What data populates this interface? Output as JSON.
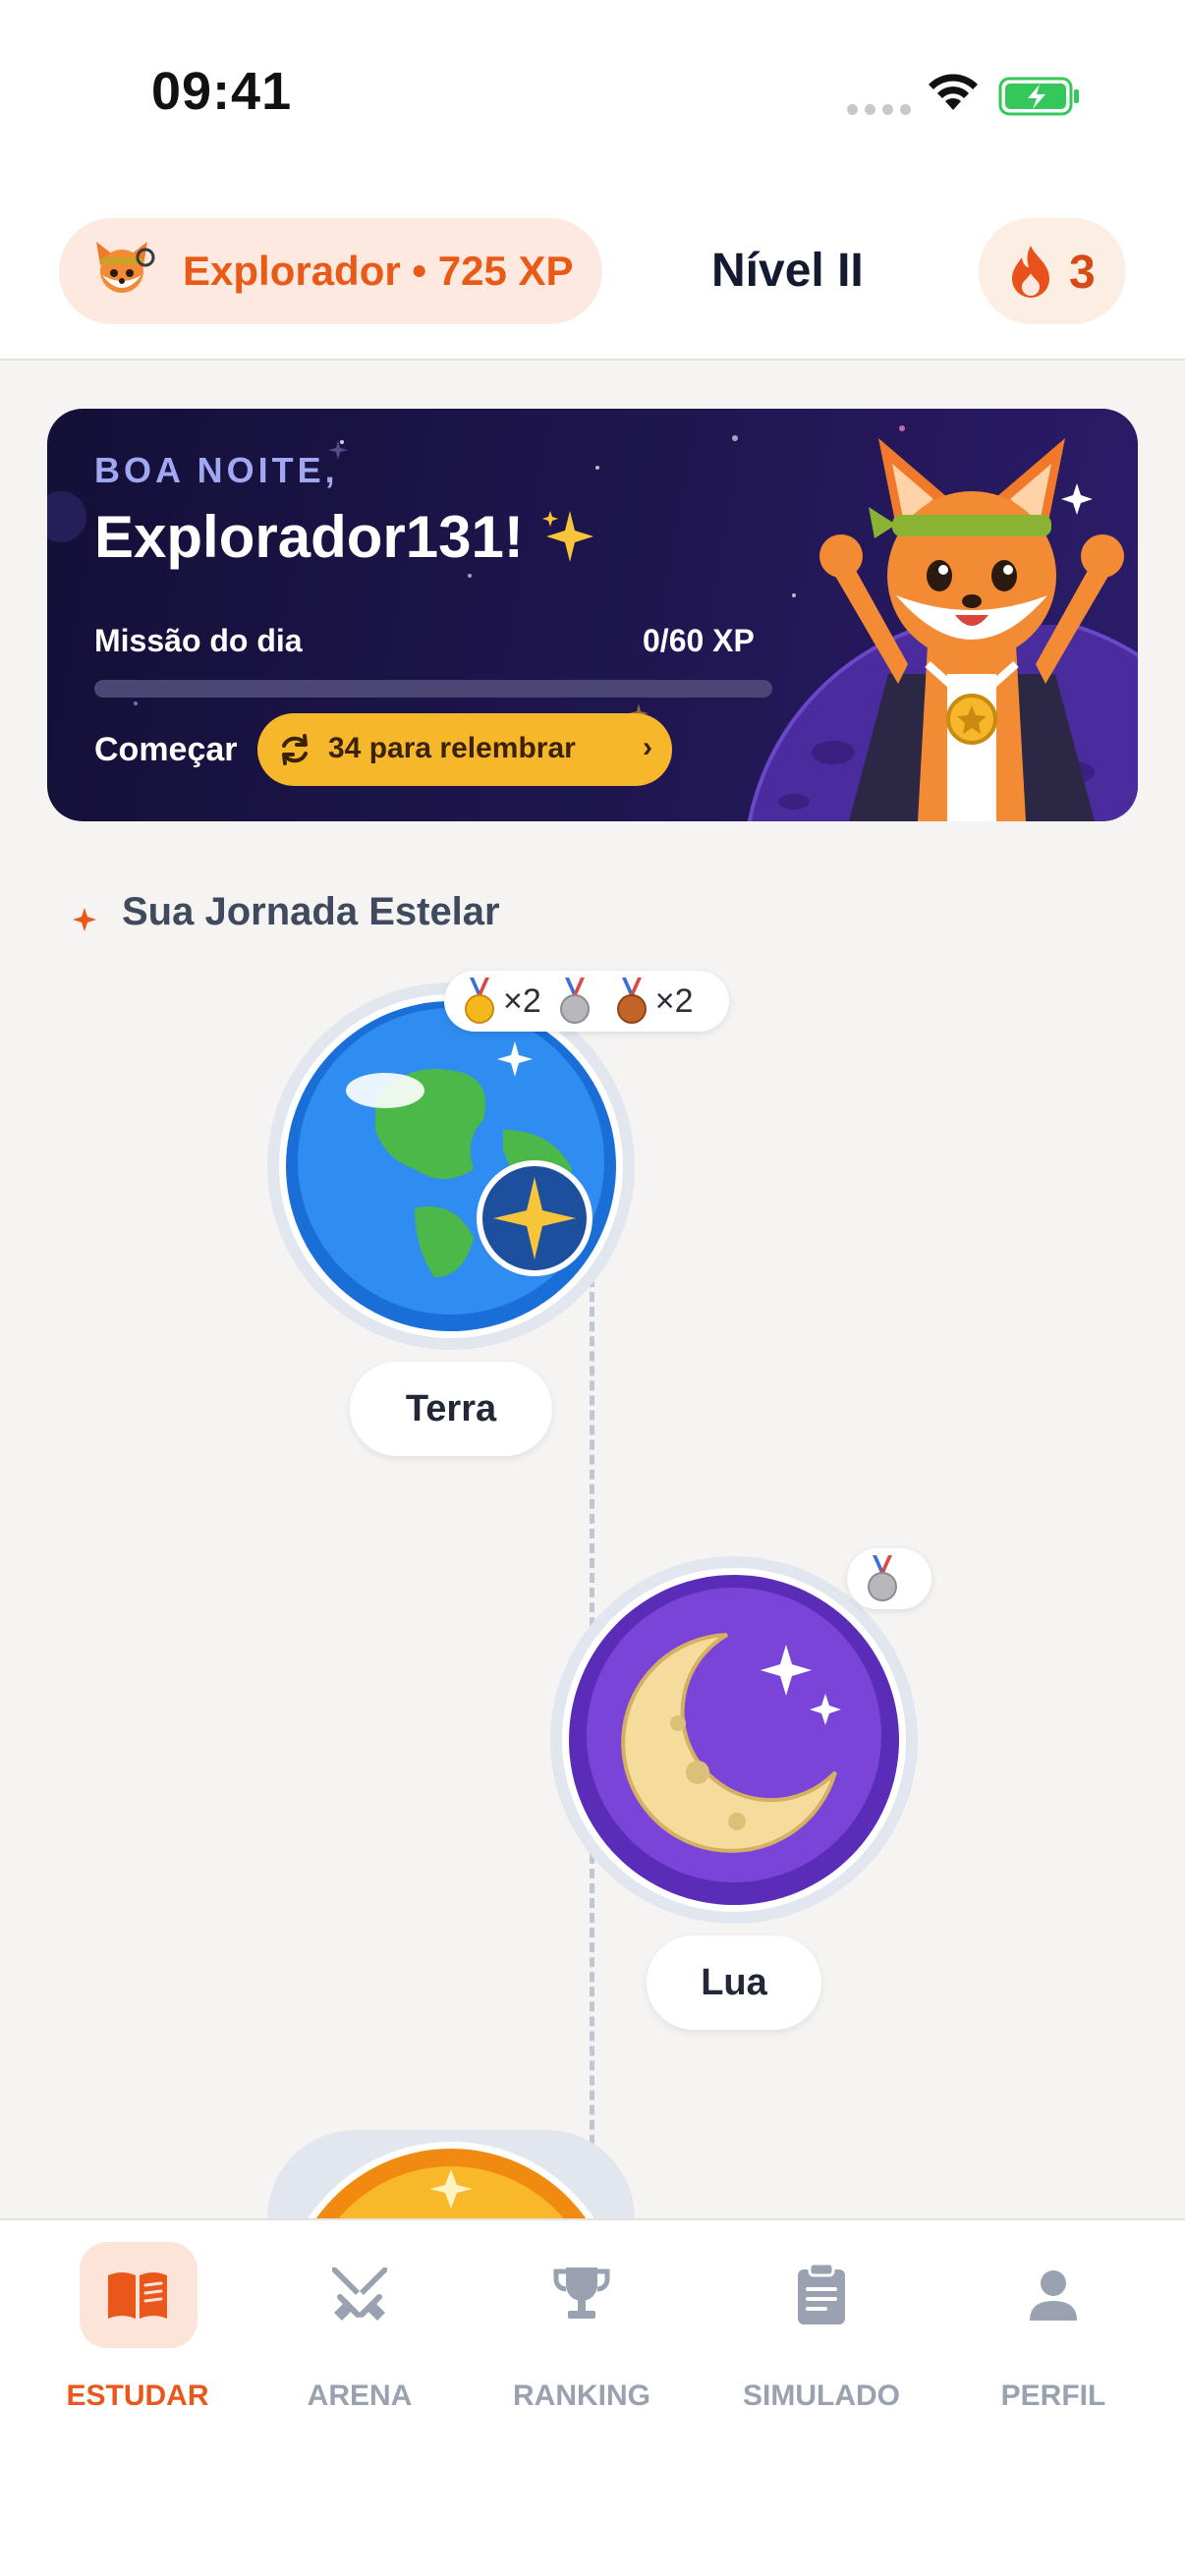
{
  "status_bar": {
    "time": "09:41"
  },
  "header": {
    "xp_label": "Explorador • 725 XP",
    "level": "Nível II",
    "streak": "3"
  },
  "banner": {
    "greeting": "BOA NOITE,",
    "username": "Explorador131!",
    "mission_label": "Missão do dia",
    "mission_xp": "0/60 XP",
    "mission_progress": 0,
    "start_label": "Começar",
    "review_label": "34 para relembrar",
    "review_chevron": "›"
  },
  "journey": {
    "title": "Sua Jornada Estelar",
    "nodes": [
      {
        "label": "Terra",
        "icon": "earth-icon",
        "medals": [
          {
            "type": "gold",
            "count": "×2"
          },
          {
            "type": "silver",
            "count": ""
          },
          {
            "type": "bronze",
            "count": "×2"
          }
        ]
      },
      {
        "label": "Lua",
        "icon": "moon-icon",
        "medals": [
          {
            "type": "silver",
            "count": ""
          }
        ]
      },
      {
        "label": "",
        "icon": "sun-icon",
        "medals": []
      }
    ]
  },
  "nav": {
    "tabs": [
      {
        "label": "ESTUDAR",
        "icon": "book-icon",
        "active": true
      },
      {
        "label": "ARENA",
        "icon": "swords-icon",
        "active": false
      },
      {
        "label": "RANKING",
        "icon": "trophy-icon",
        "active": false
      },
      {
        "label": "SIMULADO",
        "icon": "clipboard-icon",
        "active": false
      },
      {
        "label": "PERFIL",
        "icon": "person-icon",
        "active": false
      }
    ]
  },
  "colors": {
    "accent": "#ea5a17",
    "banner_bg": "#1f1650",
    "review_button": "#f6b82a",
    "inactive_nav": "#9aa2b1"
  }
}
